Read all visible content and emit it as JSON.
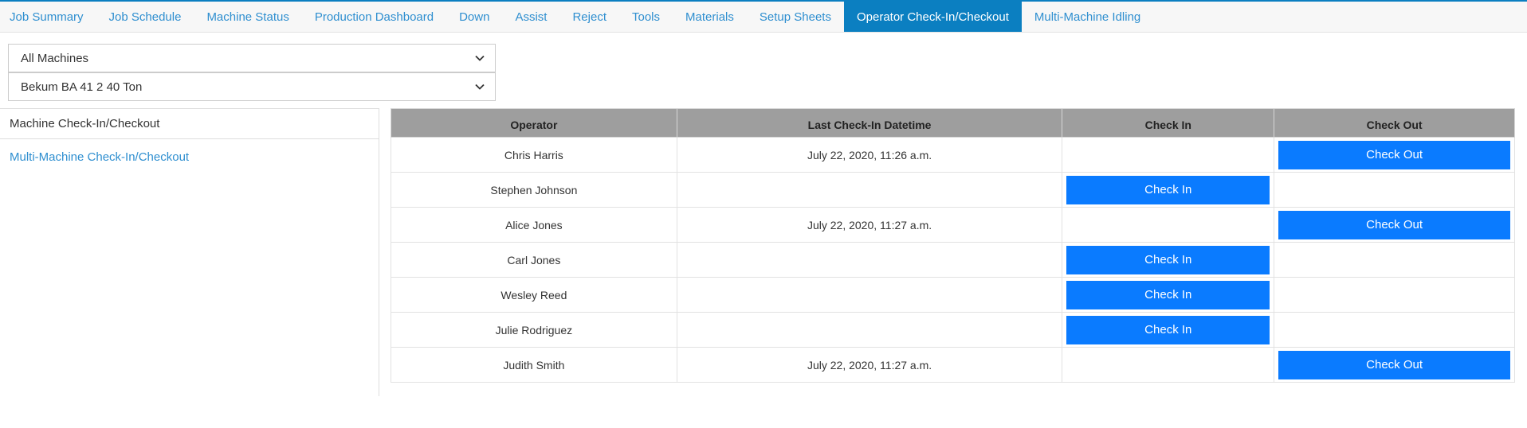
{
  "tabs": [
    {
      "label": "Job Summary",
      "name": "tab-job-summary"
    },
    {
      "label": "Job Schedule",
      "name": "tab-job-schedule"
    },
    {
      "label": "Machine Status",
      "name": "tab-machine-status"
    },
    {
      "label": "Production Dashboard",
      "name": "tab-production-dashboard"
    },
    {
      "label": "Down",
      "name": "tab-down"
    },
    {
      "label": "Assist",
      "name": "tab-assist"
    },
    {
      "label": "Reject",
      "name": "tab-reject"
    },
    {
      "label": "Tools",
      "name": "tab-tools"
    },
    {
      "label": "Materials",
      "name": "tab-materials"
    },
    {
      "label": "Setup Sheets",
      "name": "tab-setup-sheets"
    },
    {
      "label": "Operator Check-In/Checkout",
      "name": "tab-operator-check-in-checkout",
      "active": true
    },
    {
      "label": "Multi-Machine Idling",
      "name": "tab-multi-machine-idling"
    }
  ],
  "filters": {
    "machine_group": "All Machines",
    "machine": "Bekum BA 41 2 40 Ton"
  },
  "sidebar": {
    "heading": "Machine Check-In/Checkout",
    "link": "Multi-Machine Check-In/Checkout"
  },
  "table": {
    "headers": [
      "Operator",
      "Last Check-In Datetime",
      "Check In",
      "Check Out"
    ],
    "check_in_label": "Check In",
    "check_out_label": "Check Out",
    "rows": [
      {
        "operator": "Chris Harris",
        "last_check_in": "July 22, 2020, 11:26 a.m.",
        "checked_in": true
      },
      {
        "operator": "Stephen Johnson",
        "last_check_in": "",
        "checked_in": false
      },
      {
        "operator": "Alice Jones",
        "last_check_in": "July 22, 2020, 11:27 a.m.",
        "checked_in": true
      },
      {
        "operator": "Carl Jones",
        "last_check_in": "",
        "checked_in": false
      },
      {
        "operator": "Wesley Reed",
        "last_check_in": "",
        "checked_in": false
      },
      {
        "operator": "Julie Rodriguez",
        "last_check_in": "",
        "checked_in": false
      },
      {
        "operator": "Judith Smith",
        "last_check_in": "July 22, 2020, 11:27 a.m.",
        "checked_in": true
      }
    ]
  },
  "colors": {
    "accent": "#0b7fc1",
    "button": "#0a7bff",
    "link": "#2f8fd0",
    "header_bg": "#9e9e9e"
  }
}
